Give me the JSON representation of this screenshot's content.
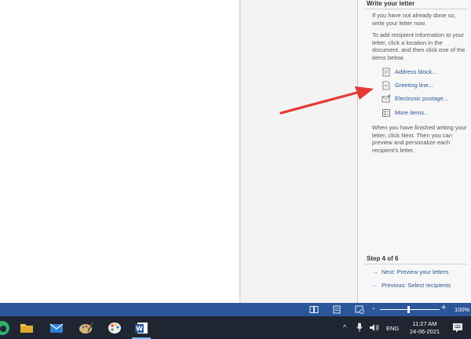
{
  "pane": {
    "title": "Write your letter",
    "intro": "If you have not already done so, write your letter now.",
    "instructions": "To add recipient information to your letter, click a location in the document, and then click one of the items below.",
    "items": [
      {
        "label": "Address block...",
        "icon": "address-block-icon"
      },
      {
        "label": "Greeting line...",
        "icon": "greeting-line-icon"
      },
      {
        "label": "Electronic postage...",
        "icon": "electronic-postage-icon"
      },
      {
        "label": "More items...",
        "icon": "more-items-icon"
      }
    ],
    "finish_text": "When you have finished writing your letter, click Next. Then you can preview and personalize each recipient's letter.",
    "step": "Step 4 of 6",
    "next_label": "Next: Preview your letters",
    "previous_label": "Previous: Select recipients"
  },
  "status_bar": {
    "zoom_minus": "-",
    "zoom_plus": "+",
    "zoom_level": "100%",
    "zoom_value_percent": 100
  },
  "taskbar": {
    "apps": [
      "edge-icon",
      "file-explorer-icon",
      "mail-icon",
      "paint-icon",
      "paint-palette-icon",
      "word-icon"
    ],
    "active_app": "word-icon",
    "tray": {
      "chevron": "^",
      "language": "ENG",
      "time": "11:27 AM",
      "date": "24-06-2021"
    }
  },
  "colors": {
    "accent_link": "#2b5797",
    "status_bar": "#2b579a",
    "taskbar": "#1f2631",
    "pointer": "#e53935"
  }
}
